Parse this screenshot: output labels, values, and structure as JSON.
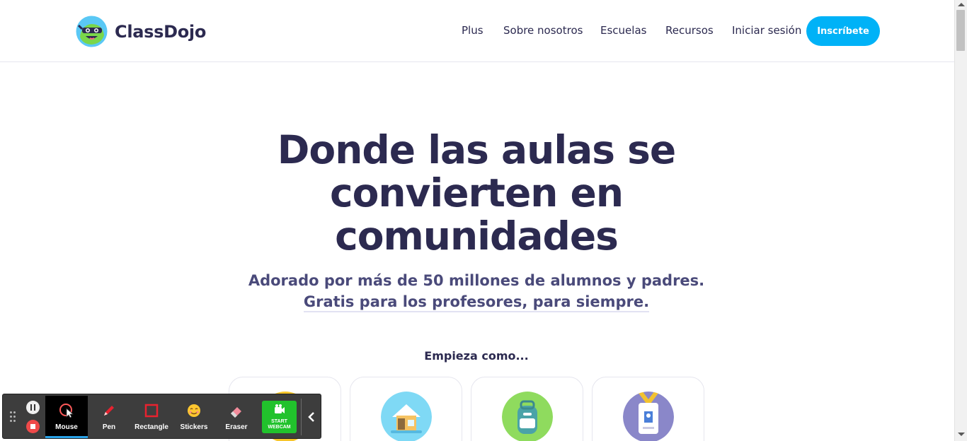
{
  "header": {
    "logo_text": "ClassDojo",
    "nav": [
      {
        "label": "Plus"
      },
      {
        "label": "Sobre nosotros"
      },
      {
        "label": "Escuelas"
      },
      {
        "label": "Recursos"
      },
      {
        "label": "Iniciar sesión"
      }
    ],
    "signup_label": "Inscríbete"
  },
  "hero": {
    "title_lines": [
      "Donde las aulas se",
      "convierten en",
      "comunidades"
    ],
    "subtitle_line1": "Adorado por más de 50 millones de alumnos y padres.",
    "subtitle_line2": "Gratis para los profesores, para siempre.",
    "start_as": "Empieza como..."
  },
  "role_cards": [
    {
      "icon": "teacher-icon",
      "color": "#f7c52a"
    },
    {
      "icon": "house-icon",
      "color": "#7fd9f5"
    },
    {
      "icon": "backpack-icon",
      "color": "#8fdb5e"
    },
    {
      "icon": "badge-icon",
      "color": "#8a87c9"
    }
  ],
  "toolbar": {
    "tools": [
      {
        "label": "Mouse",
        "icon": "mouse-pointer-icon",
        "active": true
      },
      {
        "label": "Pen",
        "icon": "pen-icon",
        "active": false
      },
      {
        "label": "Rectangle",
        "icon": "rectangle-icon",
        "active": false
      },
      {
        "label": "Stickers",
        "icon": "sticker-icon",
        "active": false
      },
      {
        "label": "Eraser",
        "icon": "eraser-icon",
        "active": false
      }
    ],
    "webcam_label_line1": "START",
    "webcam_label_line2": "WEBCAM"
  },
  "colors": {
    "brand_blue": "#00b2f7",
    "text_dark": "#2c2a50",
    "webcam_green": "#21c22c",
    "toolbar_bg": "#3d3d3d"
  }
}
